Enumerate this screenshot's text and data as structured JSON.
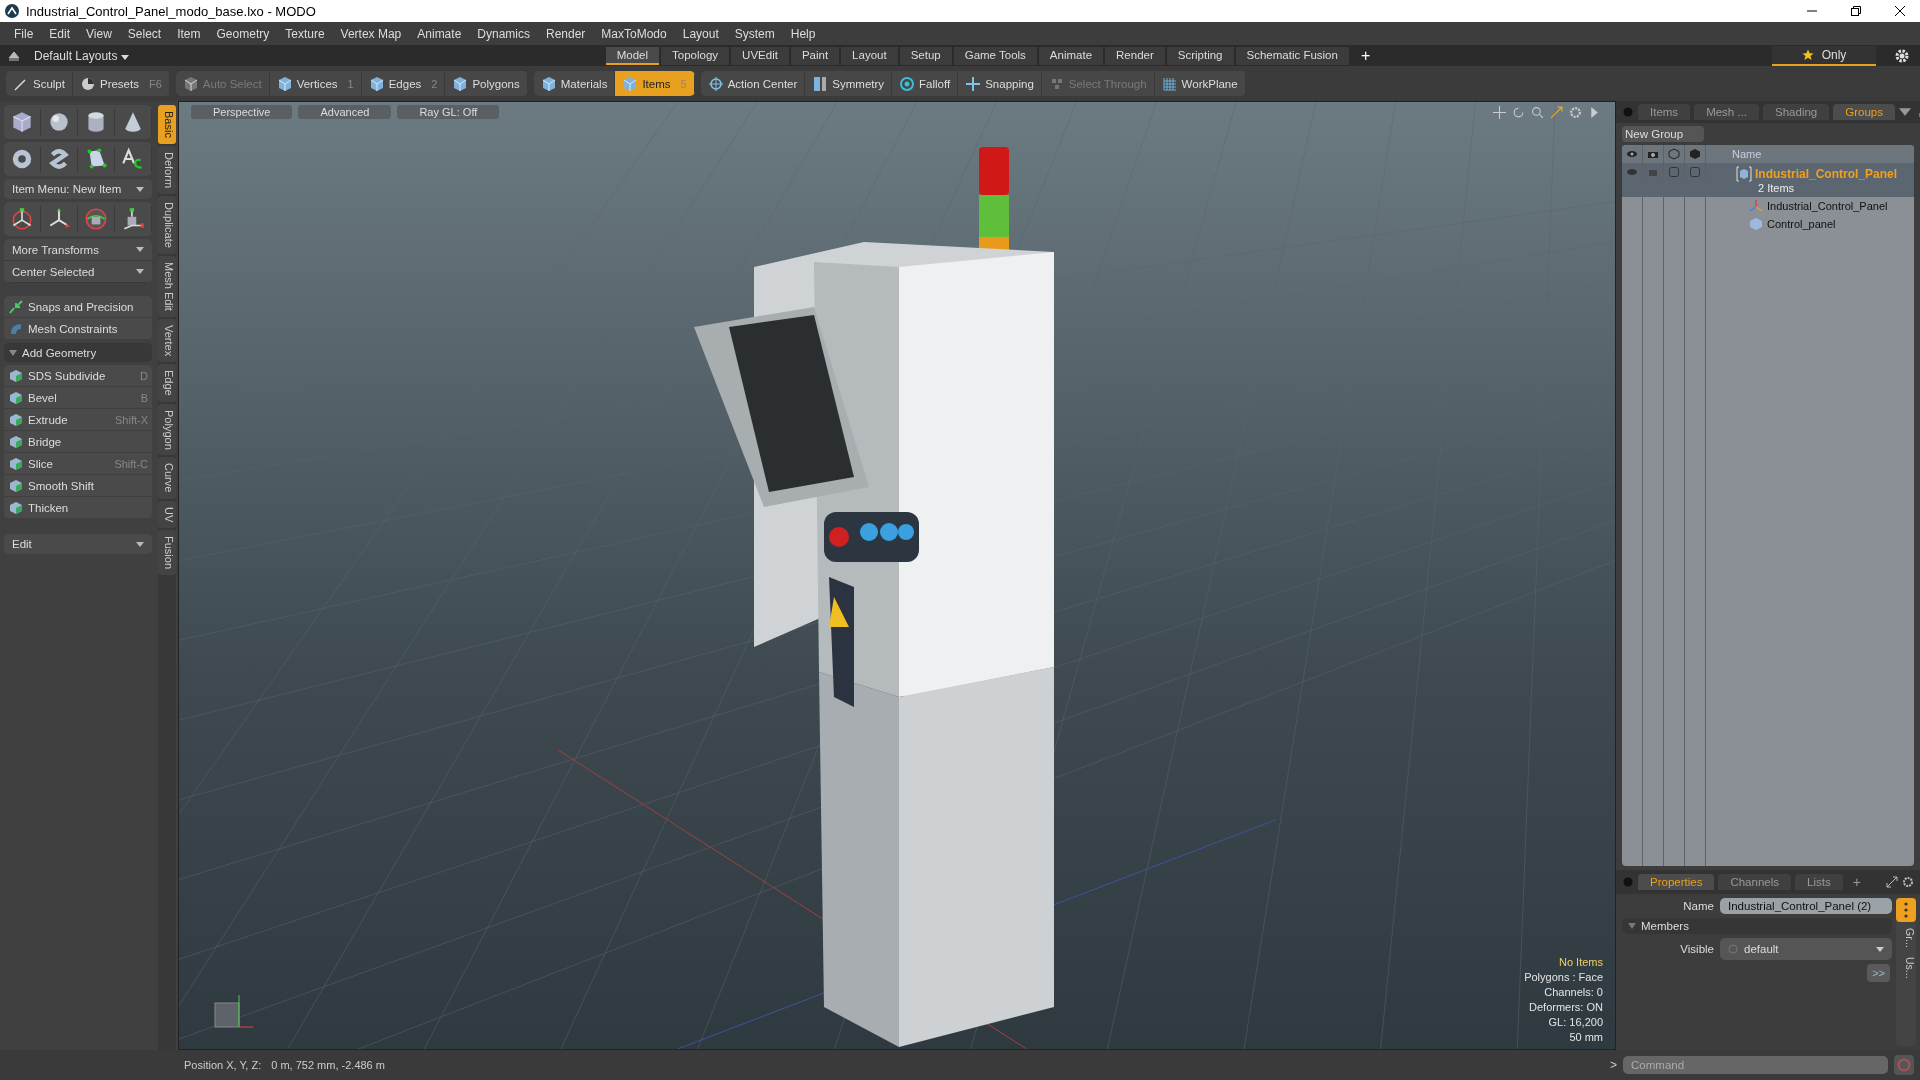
{
  "window": {
    "title": "Industrial_Control_Panel_modo_base.lxo - MODO"
  },
  "menu": [
    "File",
    "Edit",
    "View",
    "Select",
    "Item",
    "Geometry",
    "Texture",
    "Vertex Map",
    "Animate",
    "Dynamics",
    "Render",
    "MaxToModo",
    "Layout",
    "System",
    "Help"
  ],
  "layout_bar": {
    "layouts": "Default Layouts",
    "tabs": [
      {
        "label": "Model",
        "selected": true
      },
      {
        "label": "Topology",
        "selected": false
      },
      {
        "label": "UVEdit",
        "selected": false
      },
      {
        "label": "Paint",
        "selected": false
      },
      {
        "label": "Layout",
        "selected": false
      },
      {
        "label": "Setup",
        "selected": false
      },
      {
        "label": "Game Tools",
        "selected": false
      },
      {
        "label": "Animate",
        "selected": false
      },
      {
        "label": "Render",
        "selected": false
      },
      {
        "label": "Scripting",
        "selected": false
      },
      {
        "label": "Schematic Fusion",
        "selected": false
      }
    ],
    "add": "+",
    "only": "Only"
  },
  "toolbar": {
    "groups": [
      [
        {
          "label": "Sculpt",
          "kind": "brush"
        },
        {
          "label": "Presets",
          "hint": "F6",
          "kind": "preset"
        }
      ],
      [
        {
          "label": "Auto Select",
          "kind": "cube",
          "disabled": true,
          "selected": false
        },
        {
          "label": "Vertices",
          "hint": "1",
          "kind": "cube",
          "disabled": false,
          "selected": false
        },
        {
          "label": "Edges",
          "hint": "2",
          "kind": "cube",
          "disabled": false,
          "selected": false
        },
        {
          "label": "Polygons",
          "kind": "cube",
          "disabled": false,
          "selected": false
        }
      ],
      [
        {
          "label": "Materials",
          "kind": "cube",
          "disabled": false,
          "selected": false
        },
        {
          "label": "Items",
          "hint": "5",
          "kind": "cube",
          "disabled": false,
          "selected": true
        }
      ],
      [
        {
          "label": "Action Center",
          "kind": "target"
        },
        {
          "label": "Symmetry",
          "kind": "mirror"
        },
        {
          "label": "Falloff",
          "kind": "ring"
        },
        {
          "label": "Snapping",
          "kind": "snap"
        },
        {
          "label": "Select Through",
          "kind": "through",
          "disabled": true
        },
        {
          "label": "WorkPlane",
          "kind": "grid"
        }
      ]
    ]
  },
  "left_panel": {
    "item_menu": "Item Menu: New Item",
    "dropdowns": [
      "More Transforms",
      "Center Selected"
    ],
    "tools": [
      {
        "label": "Snaps and Precision"
      },
      {
        "label": "Mesh Constraints"
      }
    ],
    "section": {
      "label": "Add Geometry",
      "expanded": true
    },
    "geometry": [
      {
        "label": "SDS Subdivide",
        "hint": "D"
      },
      {
        "label": "Bevel",
        "hint": "B"
      },
      {
        "label": "Extrude",
        "hint": "Shift-X"
      },
      {
        "label": "Bridge"
      },
      {
        "label": "Slice",
        "hint": "Shift-C"
      },
      {
        "label": "Smooth Shift"
      },
      {
        "label": "Thicken"
      }
    ],
    "edit": "Edit",
    "vertical_tabs": [
      {
        "label": "Basic",
        "selected": true
      },
      {
        "label": "Deform",
        "selected": false
      },
      {
        "label": "Duplicate",
        "selected": false
      },
      {
        "label": "Mesh Edit",
        "selected": false
      },
      {
        "label": "Vertex",
        "selected": false
      },
      {
        "label": "Edge",
        "selected": false
      },
      {
        "label": "Polygon",
        "selected": false
      },
      {
        "label": "Curve",
        "selected": false
      },
      {
        "label": "UV",
        "selected": false
      },
      {
        "label": "Fusion",
        "selected": false
      }
    ]
  },
  "viewport": {
    "buttons": [
      "Perspective",
      "Advanced",
      "Ray GL: Off"
    ],
    "info": [
      {
        "text": "No Items",
        "highlight": true
      },
      {
        "text": "Polygons : Face",
        "highlight": false
      },
      {
        "text": "Channels: 0",
        "highlight": false
      },
      {
        "text": "Deformers: ON",
        "highlight": false
      },
      {
        "text": "GL: 16,200",
        "highlight": false
      },
      {
        "text": "50 mm",
        "highlight": false
      }
    ]
  },
  "status_bar": {
    "label": "Position X, Y, Z:",
    "value": "0 m, 752 mm, -2.486 m"
  },
  "groups_panel": {
    "tabs": [
      {
        "label": "Items",
        "selected": false
      },
      {
        "label": "Mesh ...",
        "selected": false
      },
      {
        "label": "Shading",
        "selected": false
      },
      {
        "label": "Groups",
        "selected": true
      }
    ],
    "new_group": "New Group",
    "column": "Name",
    "tree": [
      {
        "name": "Industrial_Control_Panel",
        "count": "2 Items",
        "selected": true,
        "children": [
          {
            "name": "Industrial_Control_Panel",
            "kind": "locator"
          },
          {
            "name": "Control_panel",
            "kind": "mesh"
          }
        ]
      }
    ]
  },
  "properties": {
    "tabs": [
      {
        "label": "Properties",
        "selected": true
      },
      {
        "label": "Channels",
        "selected": false
      },
      {
        "label": "Lists",
        "selected": false
      }
    ],
    "add": "+",
    "name_label": "Name",
    "name_value": "Industrial_Control_Panel (2)",
    "section": {
      "label": "Members",
      "expanded": true
    },
    "visible_label": "Visible",
    "visible_value": "default",
    "more": ">>",
    "side_tabs": [
      "Gr...",
      "Us..."
    ]
  },
  "command": {
    "prompt": ">",
    "placeholder": "Command"
  }
}
